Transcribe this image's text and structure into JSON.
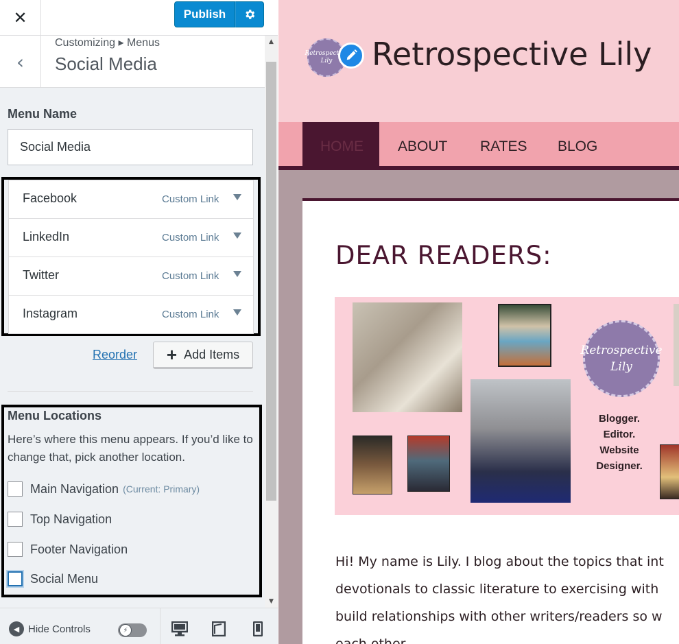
{
  "customizer": {
    "close_icon": "close-icon",
    "publish_label": "Publish",
    "publish_settings_icon": "gear-icon",
    "breadcrumb": "Customizing ▸ Menus",
    "section_title": "Social Media",
    "menu_name_label": "Menu Name",
    "menu_name_value": "Social Media",
    "menu_items": [
      {
        "label": "Facebook",
        "type": "Custom Link"
      },
      {
        "label": "LinkedIn",
        "type": "Custom Link"
      },
      {
        "label": "Twitter",
        "type": "Custom Link"
      },
      {
        "label": "Instagram",
        "type": "Custom Link"
      }
    ],
    "reorder_label": "Reorder",
    "add_items_label": "Add Items",
    "locations": {
      "title": "Menu Locations",
      "description": "Here’s where this menu appears. If you’d like to change that, pick another location.",
      "options": [
        {
          "label": "Main Navigation",
          "note": "(Current: Primary)",
          "checked": false
        },
        {
          "label": "Top Navigation",
          "note": "",
          "checked": false
        },
        {
          "label": "Footer Navigation",
          "note": "",
          "checked": false
        },
        {
          "label": "Social Menu",
          "note": "",
          "checked": false
        }
      ]
    },
    "footer": {
      "hide_controls_label": "Hide Controls",
      "devices": [
        "desktop-icon",
        "tablet-icon",
        "mobile-icon"
      ]
    }
  },
  "preview": {
    "site_title": "Retrospective Lily",
    "logo_text": "Retrospective Lily",
    "nav": [
      "HOME",
      "ABOUT",
      "RATES",
      "BLOG"
    ],
    "post_title": "DEAR READERS:",
    "collage_tagline": [
      "Blogger.",
      "Editor.",
      "Website",
      "Designer."
    ],
    "body_lines": [
      "Hi! My name is Lily. I blog about the topics that int",
      "devotionals to classic literature to exercising with",
      "build relationships with other writers/readers so w",
      "each other"
    ],
    "colors": {
      "header_bg": "#f8ced4",
      "nav_bg": "#f1a3ad",
      "accent": "#4a1630",
      "publish": "#0a8ad1"
    }
  }
}
